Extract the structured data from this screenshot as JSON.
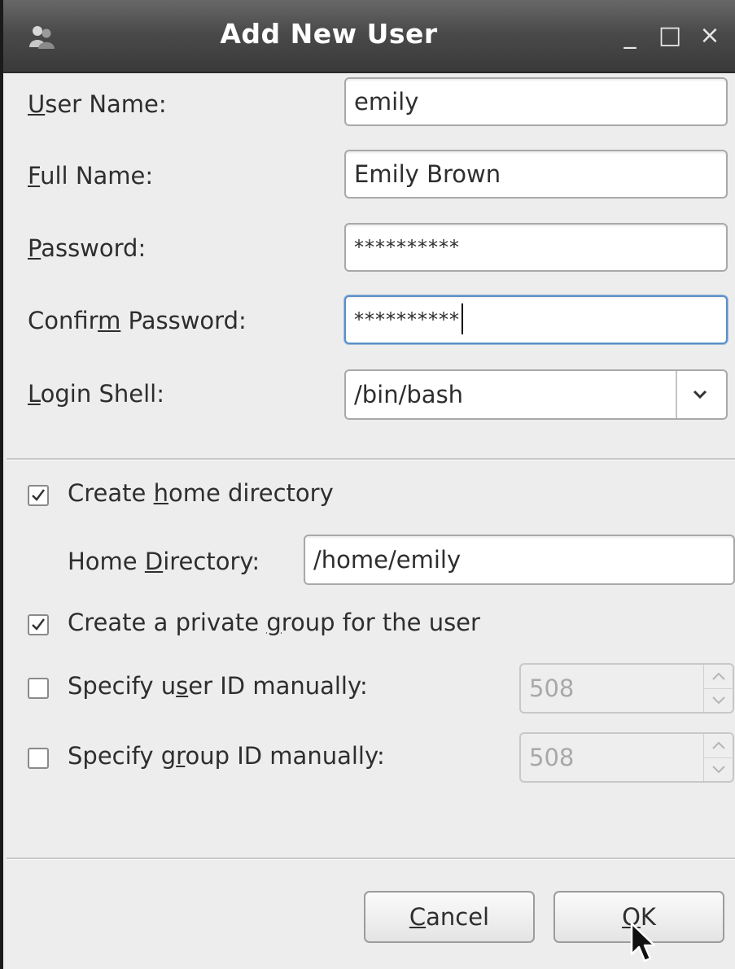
{
  "window": {
    "title": "Add New User",
    "controls": {
      "minimize": "_",
      "maximize": "□",
      "close": "×"
    },
    "icon": "users-icon"
  },
  "fields": {
    "user_name": {
      "label_key": "U",
      "label_rest": "ser Name:",
      "value": "emily"
    },
    "full_name": {
      "label_key": "F",
      "label_rest": "ull Name:",
      "value": "Emily Brown"
    },
    "password": {
      "label_key": "P",
      "label_rest": "assword:",
      "value": "**********"
    },
    "confirm_password": {
      "label_pre": "Confir",
      "label_key": "m",
      "label_rest": " Password:",
      "value": "**********"
    },
    "login_shell": {
      "label_key": "L",
      "label_rest": "ogin Shell:",
      "value": "/bin/bash"
    }
  },
  "options": {
    "create_home": {
      "label_pre": "Create ",
      "label_key": "h",
      "label_rest": "ome directory",
      "checked": true
    },
    "home_directory": {
      "label_pre": "Home ",
      "label_key": "D",
      "label_rest": "irectory:",
      "value": "/home/emily"
    },
    "private_group": {
      "label_pre": "Create a private ",
      "label_key": "g",
      "label_rest": "roup for the user",
      "checked": true
    },
    "user_id": {
      "label_pre": "Specify u",
      "label_key": "s",
      "label_rest": "er ID manually:",
      "checked": false,
      "value": "508"
    },
    "group_id": {
      "label_pre": "Specify g",
      "label_key": "r",
      "label_rest": "oup ID manually:",
      "checked": false,
      "value": "508"
    }
  },
  "buttons": {
    "cancel": {
      "label_key": "C",
      "label_rest": "ancel"
    },
    "ok": {
      "label_key": "O",
      "label_rest": "K"
    }
  },
  "colors": {
    "titlebar": "#4a4a4a",
    "background": "#ededed",
    "focus_border": "#5b8fc7"
  }
}
